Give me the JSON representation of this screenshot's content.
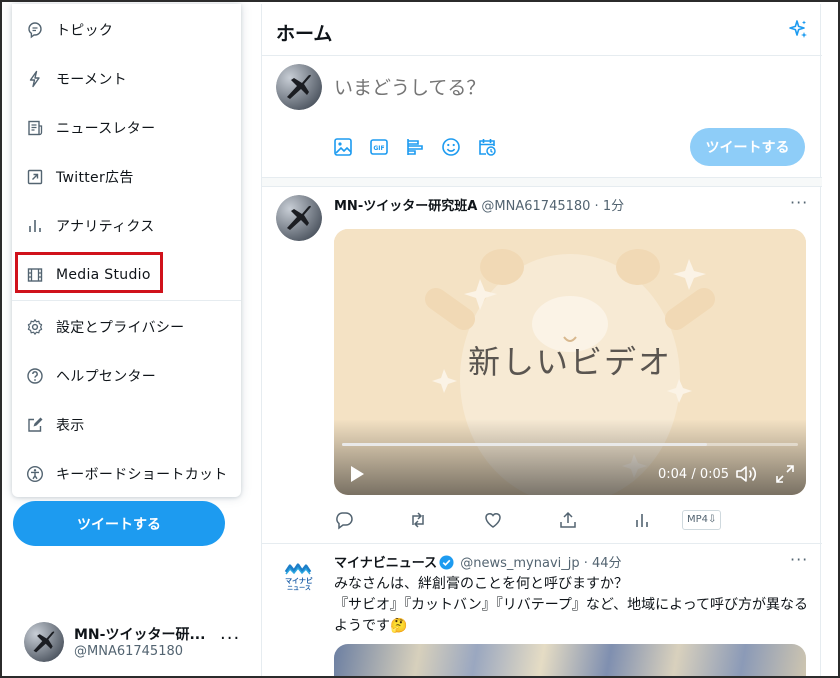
{
  "menu": {
    "items": [
      {
        "id": "topics",
        "label": "トピック",
        "icon": "topic-icon"
      },
      {
        "id": "moments",
        "label": "モーメント",
        "icon": "lightning-icon"
      },
      {
        "id": "newsletter",
        "label": "ニュースレター",
        "icon": "newsletter-icon"
      },
      {
        "id": "ads",
        "label": "Twitter広告",
        "icon": "external-arrow-icon"
      },
      {
        "id": "analytics",
        "label": "アナリティクス",
        "icon": "bar-chart-icon"
      },
      {
        "id": "media-studio",
        "label": "Media Studio",
        "icon": "film-icon"
      },
      {
        "id": "settings",
        "label": "設定とプライバシー",
        "icon": "gear-icon"
      },
      {
        "id": "help",
        "label": "ヘルプセンター",
        "icon": "question-icon"
      },
      {
        "id": "display",
        "label": "表示",
        "icon": "pen-square-icon"
      },
      {
        "id": "shortcuts",
        "label": "キーボードショートカット",
        "icon": "accessibility-icon"
      }
    ],
    "highlight_color": "#d0121b"
  },
  "sidebar": {
    "tweet_button": "ツイートする",
    "account": {
      "name": "MN-ツイッター研...",
      "handle": "@MNA61745180",
      "more": "···"
    }
  },
  "header": {
    "title": "ホーム",
    "icon": "sparkle-icon"
  },
  "composer": {
    "placeholder": "いまどうしてる？",
    "tools": [
      "image-icon",
      "gif-icon",
      "poll-icon",
      "emoji-icon",
      "schedule-icon"
    ],
    "button": "ツイートする"
  },
  "tweets": [
    {
      "name": "MN-ツイッター研究班A",
      "meta": "@MNA61745180 · 1分",
      "more": "···",
      "video": {
        "title": "新しいビデオ",
        "time": "0:04 / 0:05",
        "progress": 0.8
      },
      "actions": [
        "reply-icon",
        "retweet-icon",
        "like-icon",
        "share-icon",
        "analytics-icon"
      ],
      "badge": "MP4⇩"
    },
    {
      "name": "マイナビニュース",
      "meta": "@news_mynavi_jp · 44分",
      "more": "···",
      "logo_text": [
        "マイナビ",
        "ニュース"
      ],
      "text": "みなさんは、絆創膏のことを何と呼びますか？\n『サビオ』『カットバン』『リバテープ』など、地域によって呼び方が異なるようです🤔"
    }
  ],
  "colors": {
    "accent": "#1d9bf0",
    "accent_disabled": "#8ecdf8",
    "muted": "#536471",
    "border": "#e6ecf0"
  }
}
